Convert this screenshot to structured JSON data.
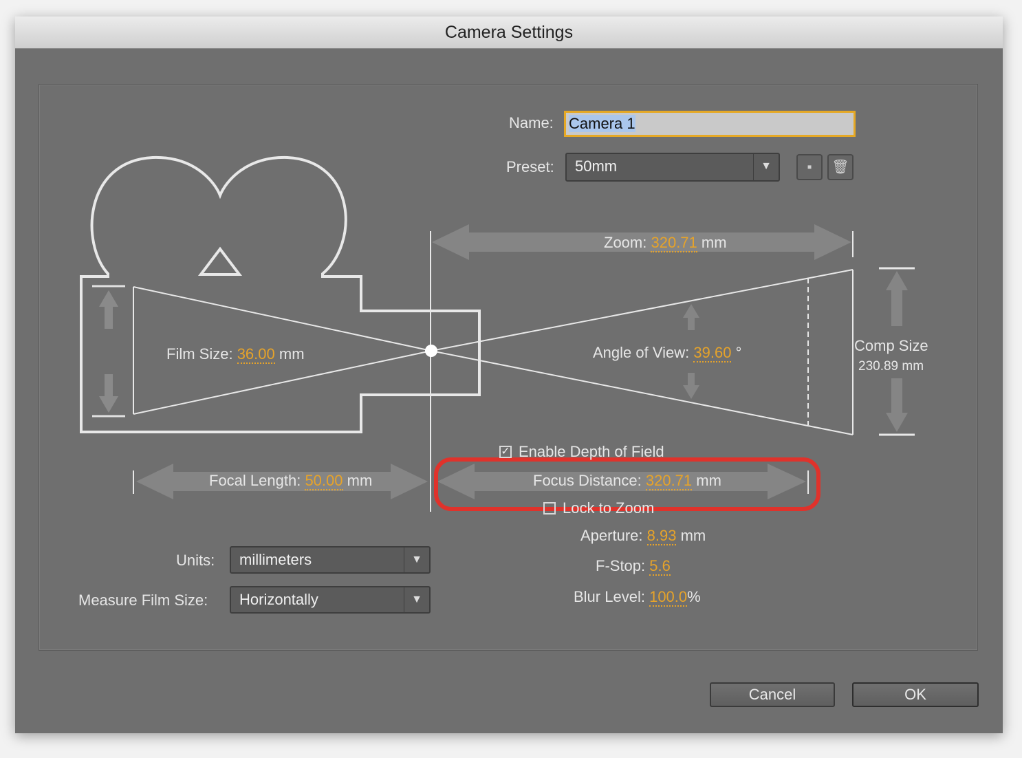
{
  "window": {
    "title": "Camera Settings"
  },
  "name": {
    "label": "Name:",
    "value": "Camera 1"
  },
  "preset": {
    "label": "Preset:",
    "value": "50mm"
  },
  "zoom": {
    "label": "Zoom:",
    "value": "320.71",
    "unit": "mm"
  },
  "film_size": {
    "label": "Film Size:",
    "value": "36.00",
    "unit": "mm"
  },
  "angle_of_view": {
    "label": "Angle of View:",
    "value": "39.60",
    "unit": "°"
  },
  "comp_size": {
    "label": "Comp Size",
    "value": "230.89 mm"
  },
  "depth_of_field": {
    "label": "Enable Depth of Field",
    "checked": true
  },
  "focal_length": {
    "label": "Focal Length:",
    "value": "50.00",
    "unit": "mm"
  },
  "focus_distance": {
    "label": "Focus Distance:",
    "value": "320.71",
    "unit": "mm"
  },
  "lock_to_zoom": {
    "label": "Lock to Zoom",
    "checked": false
  },
  "aperture": {
    "label": "Aperture:",
    "value": "8.93",
    "unit": "mm"
  },
  "fstop": {
    "label": "F-Stop:",
    "value": "5.6"
  },
  "blur_level": {
    "label": "Blur Level:",
    "value": "100.0",
    "unit": "%"
  },
  "units": {
    "label": "Units:",
    "value": "millimeters"
  },
  "measure_film": {
    "label": "Measure Film Size:",
    "value": "Horizontally"
  },
  "buttons": {
    "cancel": "Cancel",
    "ok": "OK"
  },
  "colors": {
    "accent": "#e6a32a",
    "highlight": "#e0322b",
    "panel": "#6f6f6f"
  }
}
